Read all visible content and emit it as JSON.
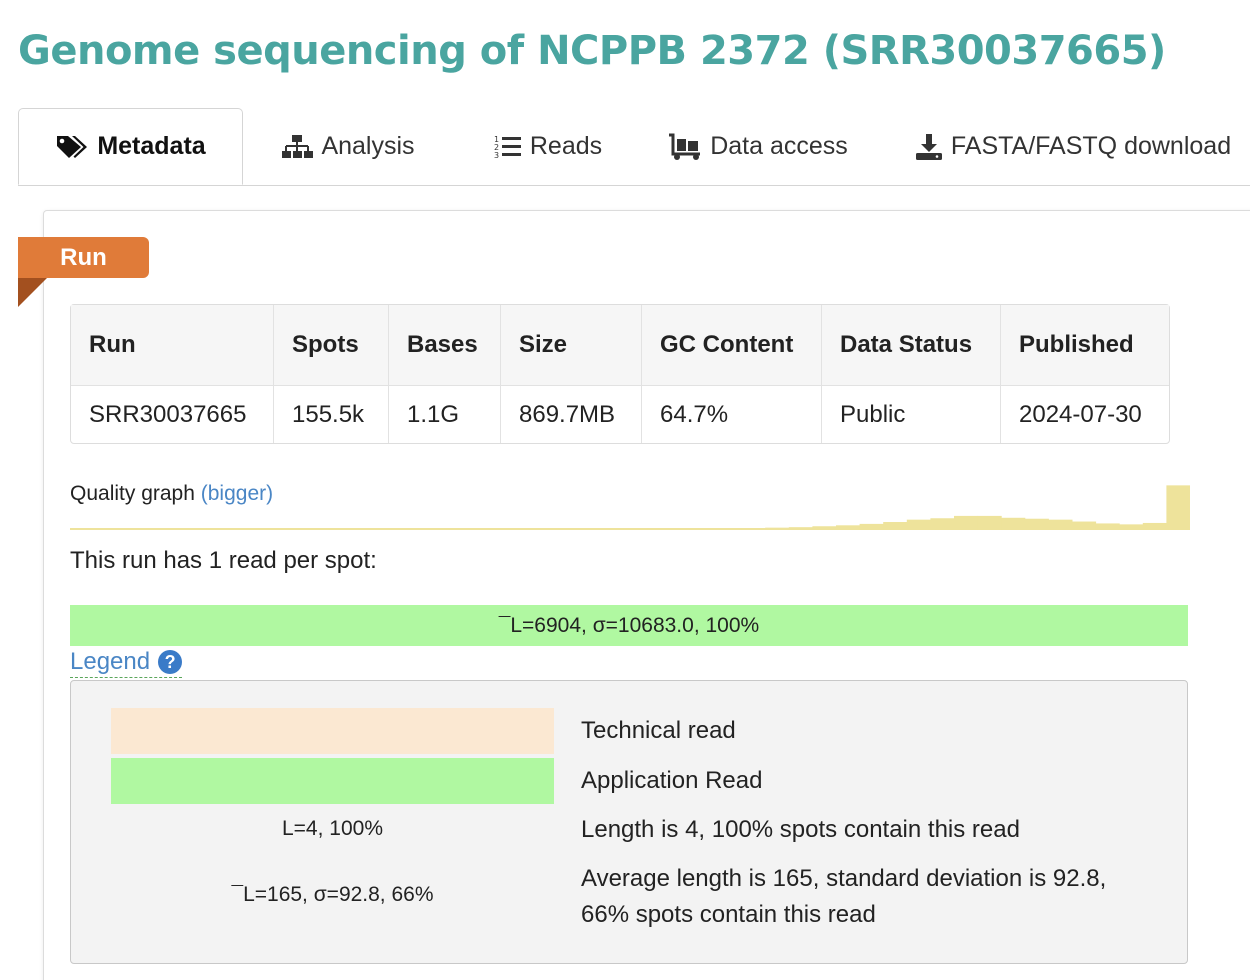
{
  "page": {
    "title": "Genome sequencing of NCPPB 2372 (SRR30037665)"
  },
  "tabs": [
    {
      "label": "Metadata",
      "icon": "tags-icon",
      "active": true
    },
    {
      "label": "Analysis",
      "icon": "sitemap-icon",
      "active": false
    },
    {
      "label": "Reads",
      "icon": "list-ol-icon",
      "active": false
    },
    {
      "label": "Data access",
      "icon": "dolly-icon",
      "active": false
    },
    {
      "label": "FASTA/FASTQ download",
      "icon": "download-icon",
      "active": false
    }
  ],
  "run_badge": "Run",
  "run_table": {
    "headers": [
      "Run",
      "Spots",
      "Bases",
      "Size",
      "GC Content",
      "Data Status",
      "Published"
    ],
    "row": [
      "SRR30037665",
      "155.5k",
      "1.1G",
      "869.7MB",
      "64.7%",
      "Public",
      "2024-07-30"
    ]
  },
  "quality": {
    "label": "Quality graph",
    "link": "(bigger)",
    "color": "#eee39b",
    "levels": [
      0.02,
      0.02,
      0.02,
      0.02,
      0.02,
      0.03,
      0.04,
      0.05,
      0.06,
      0.08,
      0.1,
      0.13,
      0.17,
      0.22,
      0.25,
      0.3,
      0.3,
      0.26,
      0.24,
      0.22,
      0.18,
      0.14,
      0.12,
      0.15,
      0.95
    ]
  },
  "reads": {
    "summary": "This run has 1 read per spot:",
    "bar_label": "¯L=6904, σ=10683.0, 100%",
    "bar_color": "#b0f8a1"
  },
  "legend": {
    "link": "Legend",
    "technical_label": "Technical read",
    "technical_color": "#fbe8d2",
    "application_label": "Application Read",
    "application_color": "#b0f8a1",
    "example1_left": "L=4, 100%",
    "example1_right": "Length is 4, 100% spots contain this read",
    "example2_left": "¯L=165, σ=92.8, 66%",
    "example2_right_line1": "Average length is 165, standard deviation is 92.8,",
    "example2_right_line2": "66% spots contain this read"
  }
}
